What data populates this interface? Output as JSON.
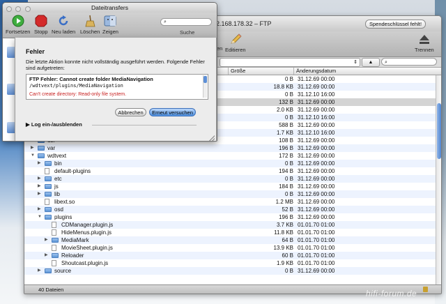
{
  "ftp_window": {
    "title": "2.168.178.32 – FTP",
    "key_button": "Spendeschlüssel fehlt!",
    "toolbar": {
      "edit_label": "Editieren",
      "disconnect_label": "Trennen",
      "partial_label": "en"
    },
    "columns": {
      "size": "Größe",
      "date": "Änderungsdatum"
    },
    "rows": [
      {
        "name": "",
        "size": "0 B",
        "date": "31.12.69 00:00",
        "type": "none",
        "indent": 0,
        "disc": ""
      },
      {
        "name": "",
        "size": "18.8 KB",
        "date": "31.12.69 00:00",
        "type": "none",
        "indent": 0,
        "disc": ""
      },
      {
        "name": "",
        "size": "0 B",
        "date": "31.12.10 16:00",
        "type": "none",
        "indent": 0,
        "disc": ""
      },
      {
        "name": "",
        "size": "132 B",
        "date": "31.12.69 00:00",
        "type": "none",
        "indent": 0,
        "disc": ""
      },
      {
        "name": "",
        "size": "2.0 KB",
        "date": "31.12.69 00:00",
        "type": "none",
        "indent": 0,
        "disc": ""
      },
      {
        "name": "",
        "size": "0 B",
        "date": "31.12.10 16:00",
        "type": "none",
        "indent": 0,
        "disc": ""
      },
      {
        "name": "",
        "size": "588 B",
        "date": "31.12.69 00:00",
        "type": "none",
        "indent": 0,
        "disc": ""
      },
      {
        "name": "",
        "size": "1.7 KB",
        "date": "31.12.10 16:00",
        "type": "none",
        "indent": 0,
        "disc": ""
      },
      {
        "name": "usr",
        "size": "108 B",
        "date": "31.12.69 00:00",
        "type": "folder",
        "indent": 0,
        "disc": "▶"
      },
      {
        "name": "var",
        "size": "196 B",
        "date": "31.12.69 00:00",
        "type": "folder",
        "indent": 0,
        "disc": "▶"
      },
      {
        "name": "wdtvext",
        "size": "172 B",
        "date": "31.12.69 00:00",
        "type": "folder",
        "indent": 0,
        "disc": "▼"
      },
      {
        "name": "bin",
        "size": "0 B",
        "date": "31.12.69 00:00",
        "type": "folder",
        "indent": 1,
        "disc": "▶"
      },
      {
        "name": "default-plugins",
        "size": "194 B",
        "date": "31.12.69 00:00",
        "type": "doc",
        "indent": 1,
        "disc": ""
      },
      {
        "name": "etc",
        "size": "0 B",
        "date": "31.12.69 00:00",
        "type": "folder",
        "indent": 1,
        "disc": "▶"
      },
      {
        "name": "js",
        "size": "184 B",
        "date": "31.12.69 00:00",
        "type": "folder",
        "indent": 1,
        "disc": "▶"
      },
      {
        "name": "lib",
        "size": "0 B",
        "date": "31.12.69 00:00",
        "type": "folder",
        "indent": 1,
        "disc": "▶"
      },
      {
        "name": "libext.so",
        "size": "1.2 MB",
        "date": "31.12.69 00:00",
        "type": "doc",
        "indent": 1,
        "disc": ""
      },
      {
        "name": "osd",
        "size": "52 B",
        "date": "31.12.69 00:00",
        "type": "folder",
        "indent": 1,
        "disc": "▶"
      },
      {
        "name": "plugins",
        "size": "196 B",
        "date": "31.12.69 00:00",
        "type": "folder",
        "indent": 1,
        "disc": "▼"
      },
      {
        "name": "CDManager.plugin.js",
        "size": "3.7 KB",
        "date": "01.01.70 01:00",
        "type": "doc",
        "indent": 2,
        "disc": ""
      },
      {
        "name": "HideMenus.plugin.js",
        "size": "11.8 KB",
        "date": "01.01.70 01:00",
        "type": "doc",
        "indent": 2,
        "disc": ""
      },
      {
        "name": "MediaMark",
        "size": "64 B",
        "date": "01.01.70 01:00",
        "type": "folder",
        "indent": 2,
        "disc": "▶"
      },
      {
        "name": "MovieSheet.plugin.js",
        "size": "13.9 KB",
        "date": "01.01.70 01:00",
        "type": "doc",
        "indent": 2,
        "disc": ""
      },
      {
        "name": "Reloader",
        "size": "60 B",
        "date": "01.01.70 01:00",
        "type": "folder",
        "indent": 2,
        "disc": "▶"
      },
      {
        "name": "Shoutcast.plugin.js",
        "size": "1.9 KB",
        "date": "01.01.70 01:00",
        "type": "doc",
        "indent": 2,
        "disc": ""
      },
      {
        "name": "source",
        "size": "0 B",
        "date": "31.12.69 00:00",
        "type": "folder",
        "indent": 1,
        "disc": "▶"
      }
    ],
    "status": "40 Dateien"
  },
  "transfers_window": {
    "title": "Dateitransfers",
    "toolbar": [
      {
        "label": "Fortsetzen",
        "icon": "resume-icon",
        "color": "#3fae3f"
      },
      {
        "label": "Stopp",
        "icon": "stop-icon",
        "color": "#d42a2a"
      },
      {
        "label": "Neu laden",
        "icon": "reload-icon",
        "color": "#3a6fc6"
      },
      {
        "label": "Löschen",
        "icon": "broom-icon",
        "color": "#b08a40"
      },
      {
        "label": "Zeigen",
        "icon": "finder-icon",
        "color": "#6b93c6"
      }
    ],
    "search_label": "Suche"
  },
  "error_sheet": {
    "heading": "Fehler",
    "message": "Die letzte Aktion konnte nicht vollständig ausgeführt werden. Folgende Fehler sind aufgetreten:",
    "error_title": "FTP Fehler: Cannot create folder MediaNavigation",
    "error_path": "/wdtvext/plugins/MediaNavigation",
    "error_detail": "Can't create directory: Read-only file system.",
    "cancel_label": "Abbrechen",
    "retry_label": "Erneut versuchen",
    "log_label": "Log ein-/ausblenden"
  },
  "watermark": "hifi-forum.de"
}
